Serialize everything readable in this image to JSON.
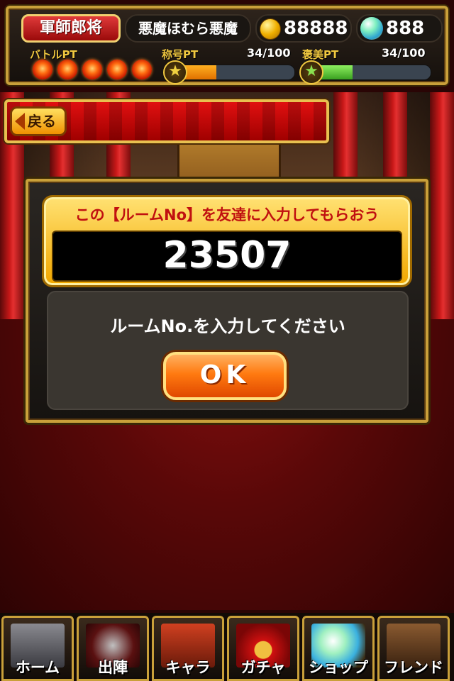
{
  "header": {
    "rank": "軍師郎将",
    "player_name": "悪魔ほむら悪魔",
    "coins": "88888",
    "gems": "888",
    "battle_pt_label": "バトルPT",
    "battle_pt_orbs": 5,
    "title_pt_label": "称号PT",
    "title_pt_count": "34/100",
    "title_pt_progress": 0.34,
    "reward_pt_label": "褒美PT",
    "reward_pt_count": "34/100",
    "reward_pt_progress": 0.34
  },
  "back_bar": {
    "back_label": "戻る"
  },
  "dialog": {
    "room_title": "この【ルームNo】を友達に入力してもらおう",
    "room_number": "23507",
    "message": "ルームNo.を入力してください",
    "ok_label": "OK"
  },
  "nav": {
    "items": [
      {
        "label": "ホーム",
        "icon": "castle-icon"
      },
      {
        "label": "出陣",
        "icon": "crossed-swords-icon"
      },
      {
        "label": "キャラ",
        "icon": "soldiers-icon"
      },
      {
        "label": "ガチャ",
        "icon": "lucky-bag-icon"
      },
      {
        "label": "ショップ",
        "icon": "crystal-orb-icon"
      },
      {
        "label": "フレンド",
        "icon": "horse-rider-icon"
      }
    ]
  },
  "colors": {
    "gold_frame": "#c9a03a",
    "title_red": "#c01010",
    "ok_orange": "#ff7a10"
  }
}
